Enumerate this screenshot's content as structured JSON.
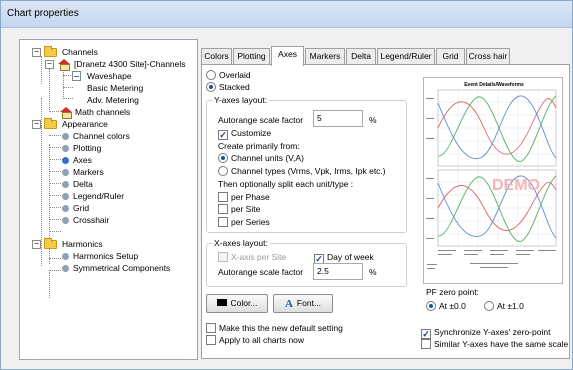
{
  "window": {
    "title": "Chart properties"
  },
  "tree": {
    "nodes": [
      {
        "label": "Channels",
        "icon": "folder-icon",
        "expander": "−"
      },
      {
        "label": "[Dranetz 4300 Site]-Channels",
        "icon": "site-icon",
        "expander": "−"
      },
      {
        "label": "Waveshape",
        "icon": "document-icon"
      },
      {
        "label": "Basic Metering",
        "icon": "document-icon"
      },
      {
        "label": "Adv. Metering",
        "icon": "document-icon"
      },
      {
        "label": "Math channels",
        "icon": "site-icon"
      },
      {
        "label": "Appearance",
        "icon": "folder-icon",
        "expander": "−"
      },
      {
        "label": "Channel colors",
        "icon": "gear-icon"
      },
      {
        "label": "Plotting",
        "icon": "gear-icon"
      },
      {
        "label": "Axes",
        "icon": "gear-icon",
        "selected": true
      },
      {
        "label": "Markers",
        "icon": "gear-icon"
      },
      {
        "label": "Delta",
        "icon": "gear-icon"
      },
      {
        "label": "Legend/Ruler",
        "icon": "gear-icon"
      },
      {
        "label": "Grid",
        "icon": "gear-icon"
      },
      {
        "label": "Crosshair",
        "icon": "gear-icon"
      },
      {
        "label": "Harmonics",
        "icon": "folder-icon",
        "expander": "−"
      },
      {
        "label": "Harmonics Setup",
        "icon": "gear-icon"
      },
      {
        "label": "Symmetrical Components",
        "icon": "gear-icon"
      }
    ]
  },
  "tabs": [
    "Colors",
    "Plotting",
    "Axes",
    "Markers",
    "Delta",
    "Legend/Ruler",
    "Grid",
    "Cross hair"
  ],
  "active_tab": "Axes",
  "axes": {
    "overlaid": "Overlaid",
    "stacked": "Stacked",
    "yaxes_group": "Y-axes layout:",
    "autorange_label": "Autorange scale factor",
    "autorange_value": "5",
    "percent": "%",
    "customize": "Customize",
    "create_from": "Create primarily from:",
    "channel_units": "Channel units (V,A)",
    "channel_types": "Channel types (Vrms, Vpk, Irms, Ipk etc.)",
    "split_label": "Then optionally split each unit/type :",
    "per_phase": "per Phase",
    "per_site": "per Site",
    "per_series": "per Series",
    "xaxes_group": "X-axes layout:",
    "xaxis_per_site": "X-axis per Site",
    "day_of_week": "Day of week",
    "x_autorange_label": "Autorange scale factor",
    "x_autorange_value": "2.5",
    "x_percent": "%",
    "color_button": "Color...",
    "font_button": "Font...",
    "make_default": "Make this the new default setting",
    "apply_all": "Apply to all charts now",
    "pf_group": "PF zero point:",
    "pf_zero": "At ±0.0",
    "pf_one": "At ±1.0",
    "sync_zero": "Synchronize Y-axes' zero-point",
    "similar_scale": "Similar Y-axes have the same scale"
  },
  "preview": {
    "title": "Event Details/Waveforms",
    "watermark": "DEMO"
  },
  "colors": {
    "selected_check": "#1b3f7a",
    "wave_red": "#e06666",
    "wave_blue": "#5b8bd6",
    "wave_green": "#55b06a"
  }
}
